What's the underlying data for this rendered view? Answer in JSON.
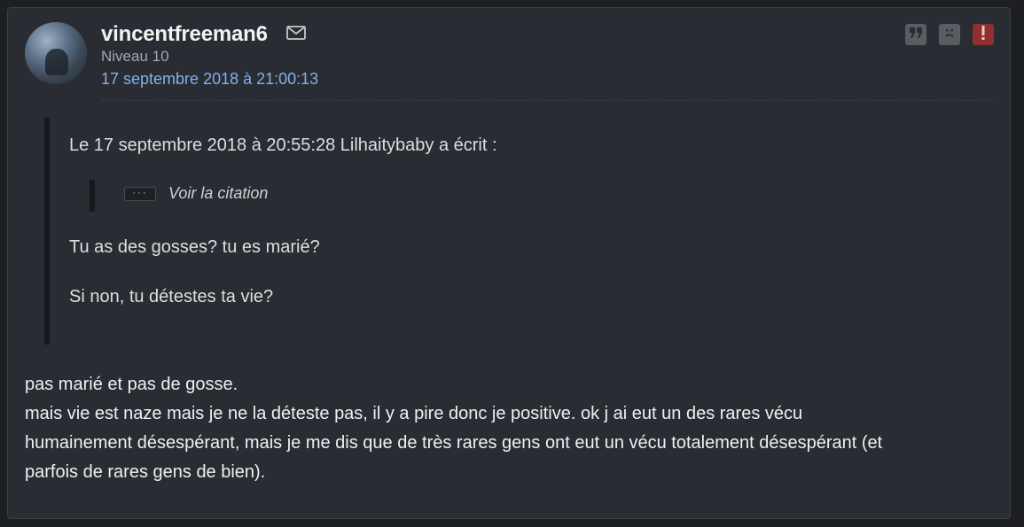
{
  "post": {
    "username": "vincentfreeman6",
    "level": "Niveau 10",
    "date": "17 septembre 2018 à 21:00:13",
    "icons": {
      "mail": "mail-icon",
      "quote": "quote-icon",
      "sad": "sad-face-icon",
      "report": "report-alert-icon"
    },
    "colors": {
      "background": "#2a2c33",
      "date_link": "#7fb3e8",
      "report": "#8f2f2f"
    }
  },
  "quote": {
    "header": "Le 17 septembre 2018 à 20:55:28 Lilhaitybaby a écrit :",
    "nested_button": "···",
    "nested_label": "Voir la citation",
    "lines": [
      "Tu as des gosses? tu es marié?",
      "Si non, tu détestes ta vie?"
    ]
  },
  "message": {
    "lines": [
      "pas marié et pas de gosse.",
      "mais vie est naze mais je ne la déteste pas, il y a pire donc je positive. ok j ai eut un des rares vécu",
      "humainement désespérant, mais je me dis que de très rares gens ont eut un vécu totalement désespérant (et",
      "parfois de rares gens de bien)."
    ]
  }
}
